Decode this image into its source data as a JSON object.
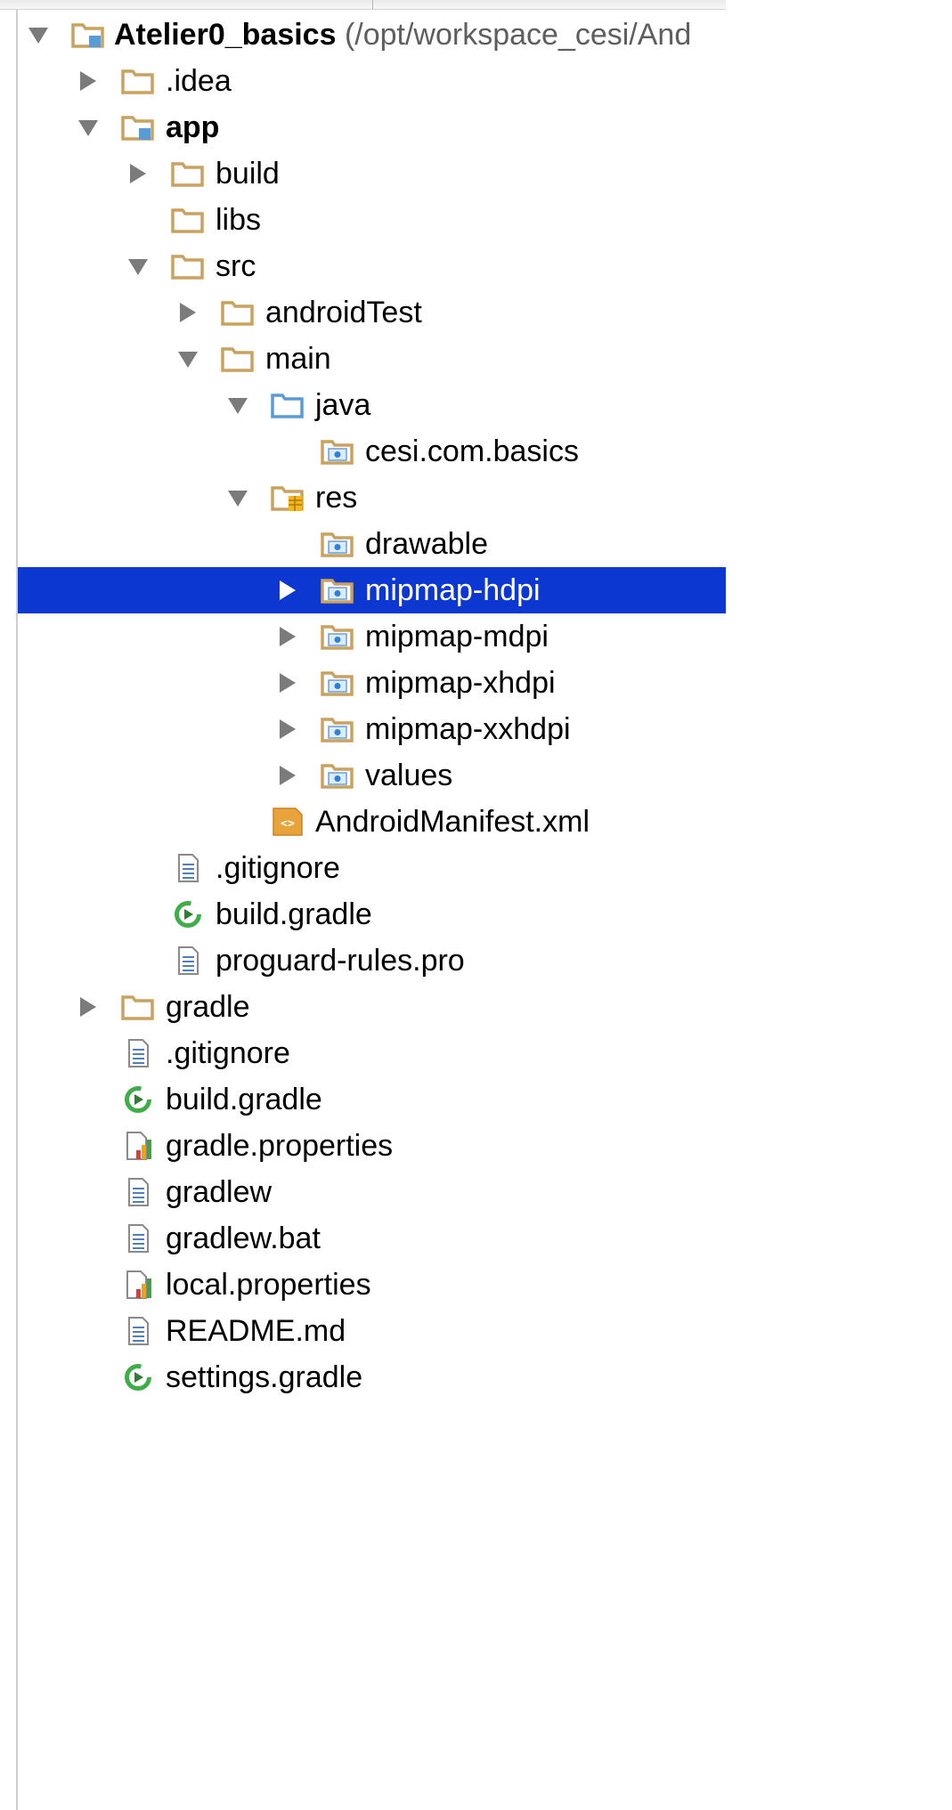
{
  "window": {
    "panel": "Project"
  },
  "colors": {
    "selection": "#0c37d1",
    "folder": "#c9a25f",
    "source_folder": "#5b9bd5",
    "gradle_green": "#3fae49",
    "manifest_orange": "#e8a43a"
  },
  "tree": [
    {
      "label": "Atelier0_basics",
      "suffix": " (/opt/workspace_cesi/And",
      "depth": 0,
      "arrow": "open",
      "icon": "module-folder",
      "bold": true
    },
    {
      "label": ".idea",
      "depth": 1,
      "arrow": "closed",
      "icon": "folder"
    },
    {
      "label": "app",
      "depth": 1,
      "arrow": "open",
      "icon": "module-folder",
      "bold": true
    },
    {
      "label": "build",
      "depth": 2,
      "arrow": "closed",
      "icon": "folder"
    },
    {
      "label": "libs",
      "depth": 2,
      "arrow": "none",
      "icon": "folder"
    },
    {
      "label": "src",
      "depth": 2,
      "arrow": "open",
      "icon": "folder"
    },
    {
      "label": "androidTest",
      "depth": 3,
      "arrow": "closed",
      "icon": "folder"
    },
    {
      "label": "main",
      "depth": 3,
      "arrow": "open",
      "icon": "folder"
    },
    {
      "label": "java",
      "depth": 4,
      "arrow": "open",
      "icon": "source-folder"
    },
    {
      "label": "cesi.com.basics",
      "depth": 5,
      "arrow": "none",
      "icon": "package-folder"
    },
    {
      "label": "res",
      "depth": 4,
      "arrow": "open",
      "icon": "resources-folder"
    },
    {
      "label": "drawable",
      "depth": 5,
      "arrow": "none",
      "icon": "package-folder"
    },
    {
      "label": "mipmap-hdpi",
      "depth": 5,
      "arrow": "closed",
      "icon": "package-folder",
      "selected": true
    },
    {
      "label": "mipmap-mdpi",
      "depth": 5,
      "arrow": "closed",
      "icon": "package-folder"
    },
    {
      "label": "mipmap-xhdpi",
      "depth": 5,
      "arrow": "closed",
      "icon": "package-folder"
    },
    {
      "label": "mipmap-xxhdpi",
      "depth": 5,
      "arrow": "closed",
      "icon": "package-folder"
    },
    {
      "label": "values",
      "depth": 5,
      "arrow": "closed",
      "icon": "package-folder"
    },
    {
      "label": "AndroidManifest.xml",
      "depth": 4,
      "arrow": "none",
      "icon": "manifest-file"
    },
    {
      "label": ".gitignore",
      "depth": 2,
      "arrow": "none",
      "icon": "text-file"
    },
    {
      "label": "build.gradle",
      "depth": 2,
      "arrow": "none",
      "icon": "gradle-file"
    },
    {
      "label": "proguard-rules.pro",
      "depth": 2,
      "arrow": "none",
      "icon": "text-file"
    },
    {
      "label": "gradle",
      "depth": 1,
      "arrow": "closed",
      "icon": "folder"
    },
    {
      "label": ".gitignore",
      "depth": 1,
      "arrow": "none",
      "icon": "text-file"
    },
    {
      "label": "build.gradle",
      "depth": 1,
      "arrow": "none",
      "icon": "gradle-file"
    },
    {
      "label": "gradle.properties",
      "depth": 1,
      "arrow": "none",
      "icon": "properties-file"
    },
    {
      "label": "gradlew",
      "depth": 1,
      "arrow": "none",
      "icon": "text-file"
    },
    {
      "label": "gradlew.bat",
      "depth": 1,
      "arrow": "none",
      "icon": "text-file"
    },
    {
      "label": "local.properties",
      "depth": 1,
      "arrow": "none",
      "icon": "properties-file"
    },
    {
      "label": "README.md",
      "depth": 1,
      "arrow": "none",
      "icon": "text-file"
    },
    {
      "label": "settings.gradle",
      "depth": 1,
      "arrow": "none",
      "icon": "gradle-file"
    }
  ]
}
